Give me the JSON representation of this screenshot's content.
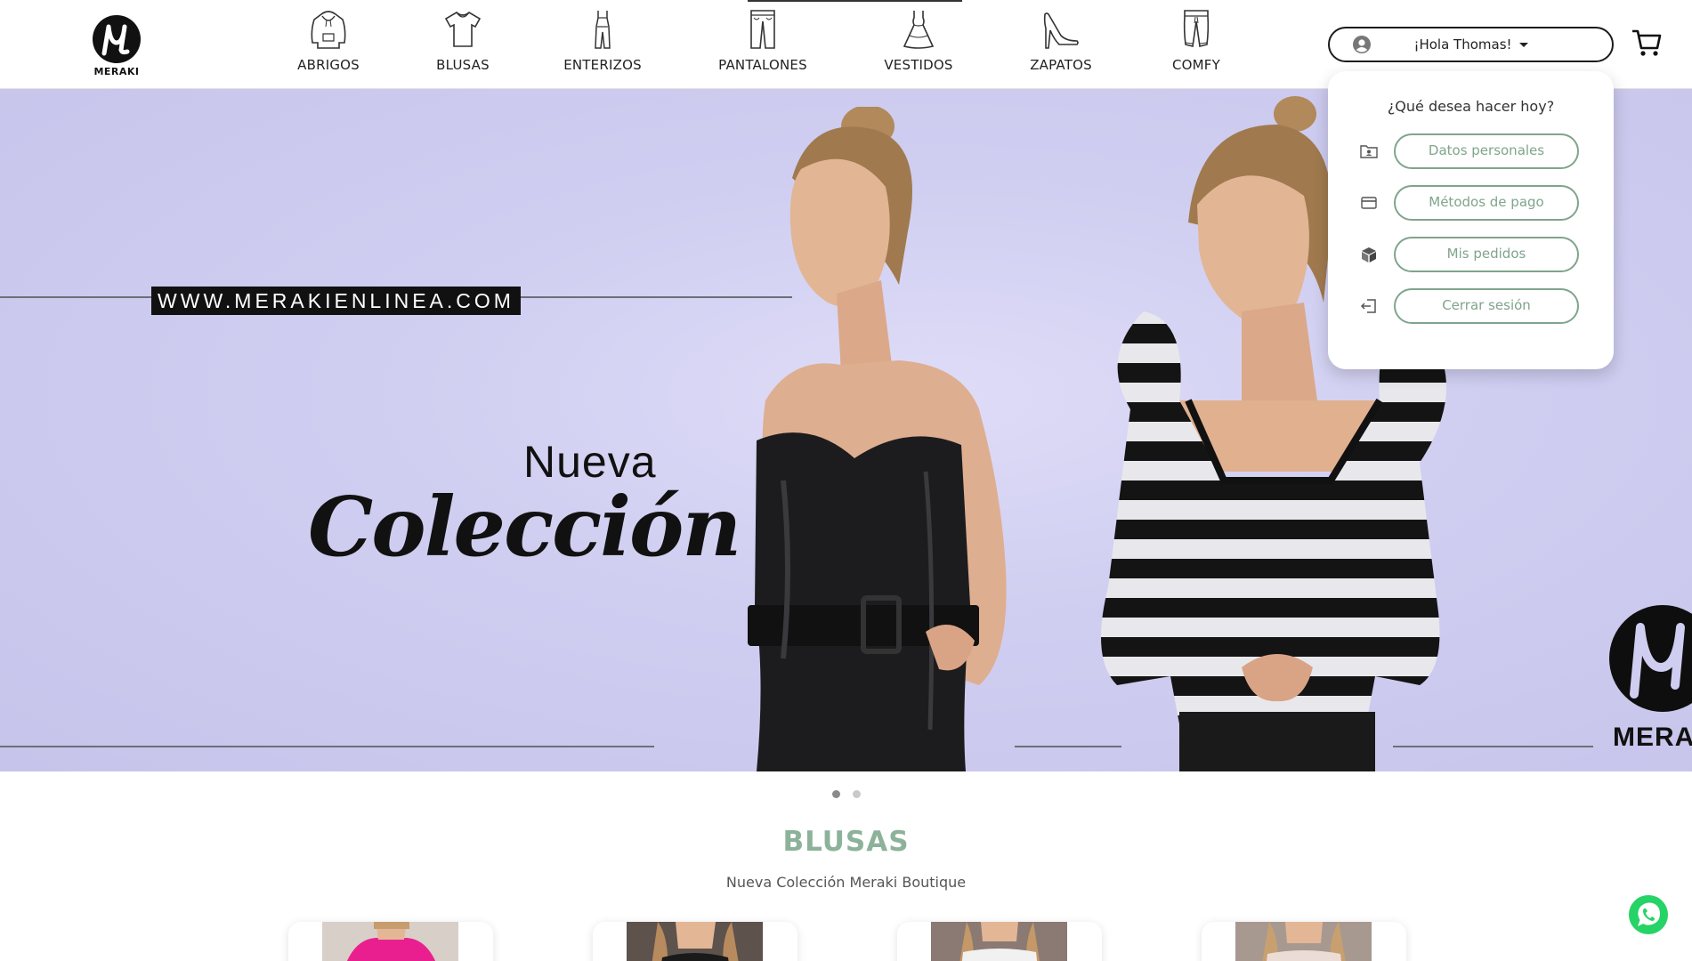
{
  "brand": {
    "name": "MERAKI"
  },
  "nav": {
    "items": [
      {
        "label": "ABRIGOS",
        "icon": "hoodie-icon"
      },
      {
        "label": "BLUSAS",
        "icon": "tshirt-icon"
      },
      {
        "label": "ENTERIZOS",
        "icon": "jumpsuit-icon"
      },
      {
        "label": "PANTALONES",
        "icon": "pants-icon"
      },
      {
        "label": "VESTIDOS",
        "icon": "dress-icon"
      },
      {
        "label": "ZAPATOS",
        "icon": "high-heel-icon"
      },
      {
        "label": "COMFY",
        "icon": "joggers-icon"
      }
    ],
    "active": "PANTALONES"
  },
  "user": {
    "greeting": "¡Hola Thomas!",
    "icon": "user-circle-icon"
  },
  "cart": {
    "icon": "cart-icon"
  },
  "user_menu": {
    "title": "¿Qué desea hacer hoy?",
    "items": [
      {
        "label": "Datos personales",
        "icon": "id-folder-icon"
      },
      {
        "label": "Métodos de pago",
        "icon": "credit-card-icon"
      },
      {
        "label": "Mis pedidos",
        "icon": "box-icon"
      },
      {
        "label": "Cerrar sesión",
        "icon": "logout-icon"
      }
    ]
  },
  "hero": {
    "url": "WWW.MERAKIENLINEA.COM",
    "headline_top": "Nueva",
    "headline_main": "Colección",
    "watermark": "MERAKI",
    "slides": 2,
    "active_slide": 1
  },
  "section": {
    "title": "BLUSAS",
    "subtitle": "Nueva Colección Meraki Boutique"
  },
  "whatsapp": {
    "icon": "whatsapp-icon"
  },
  "colors": {
    "accent_green": "#8db29a",
    "button_green": "#7fa58c",
    "hero_bg": "#d3d1f2",
    "text_dark": "#222222"
  }
}
